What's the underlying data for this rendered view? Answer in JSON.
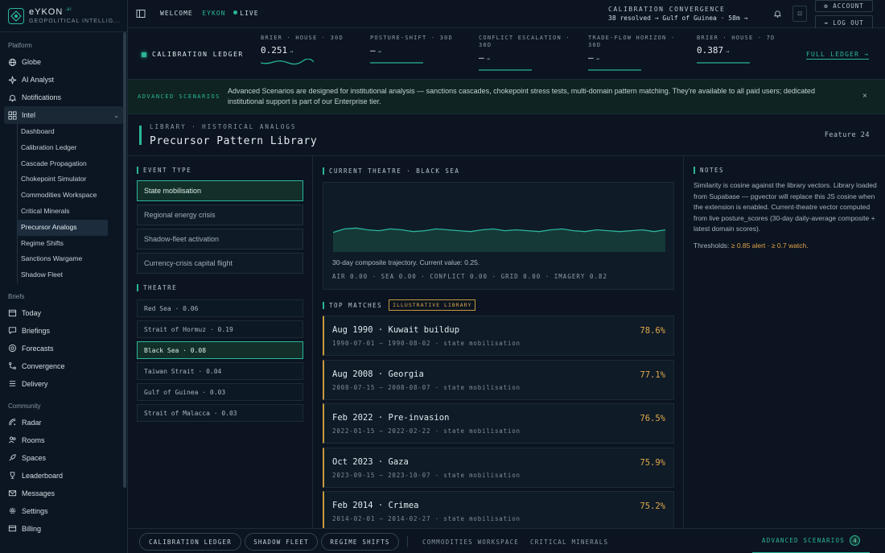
{
  "brand": {
    "name": "eYKON",
    "suffix": ".ai",
    "subtitle": "GEOPOLITICAL INTELLIG..."
  },
  "sidebar": {
    "platform_label": "Platform",
    "platform": [
      {
        "label": "Globe",
        "icon": "globe-icon"
      },
      {
        "label": "AI Analyst",
        "icon": "sparkle-icon"
      },
      {
        "label": "Notifications",
        "icon": "bell-icon"
      }
    ],
    "intel": {
      "label": "Intel",
      "icon": "grid-icon"
    },
    "intel_items": [
      "Dashboard",
      "Calibration Ledger",
      "Cascade Propagation",
      "Chokepoint Simulator",
      "Commodities Workspace",
      "Critical Minerals",
      "Precursor Analogs",
      "Regime Shifts",
      "Sanctions Wargame",
      "Shadow Fleet"
    ],
    "intel_active": "Precursor Analogs",
    "briefs_label": "Briefs",
    "briefs": [
      {
        "label": "Today",
        "icon": "calendar-icon"
      },
      {
        "label": "Briefings",
        "icon": "chat-icon"
      },
      {
        "label": "Forecasts",
        "icon": "target-icon"
      },
      {
        "label": "Convergence",
        "icon": "merge-icon"
      },
      {
        "label": "Delivery",
        "icon": "list-icon"
      }
    ],
    "community_label": "Community",
    "community": [
      {
        "label": "Radar",
        "icon": "radar-icon"
      },
      {
        "label": "Rooms",
        "icon": "people-icon"
      },
      {
        "label": "Spaces",
        "icon": "rocket-icon"
      },
      {
        "label": "Leaderboard",
        "icon": "trophy-icon"
      },
      {
        "label": "Messages",
        "icon": "mail-icon"
      },
      {
        "label": "Settings",
        "icon": "gear-icon"
      },
      {
        "label": "Billing",
        "icon": "card-icon"
      }
    ]
  },
  "topbar": {
    "welcome": "WELCOME",
    "user": "EYKON",
    "live": "LIVE",
    "conv_l1": "CALIBRATION  CONVERGENCE",
    "conv_l2": "38 resolved → Gulf of Guinea · 58m →",
    "small_btn": "⊡",
    "account": "ACCOUNT",
    "logout": "LOG OUT"
  },
  "ledger": {
    "title": "CALIBRATION LEDGER",
    "metrics": [
      {
        "label": "BRIER · HOUSE · 30D",
        "value": "0.251",
        "arrow": "→"
      },
      {
        "label": "POSTURE-SHIFT · 30D",
        "value": "—",
        "arrow": "→"
      },
      {
        "label": "CONFLICT ESCALATION · 30D",
        "value": "—",
        "arrow": "→"
      },
      {
        "label": "TRADE-FLOW HORIZON · 30D",
        "value": "—",
        "arrow": "→"
      },
      {
        "label": "BRIER · HOUSE · 7D",
        "value": "0.387",
        "arrow": "→"
      }
    ],
    "full": "FULL LEDGER →"
  },
  "banner": {
    "tag": "ADVANCED SCENARIOS",
    "text": "Advanced Scenarios are designed for institutional analysis — sanctions cascades, chokepoint stress tests, multi-domain pattern matching. They're available to all paid users; dedicated institutional support is part of our Enterprise tier.",
    "close": "×"
  },
  "header": {
    "crumb": "LIBRARY · HISTORICAL ANALOGS",
    "title": "Precursor Pattern Library",
    "feature": "Feature 24"
  },
  "event_type": {
    "label": "EVENT TYPE",
    "items": [
      "State mobilisation",
      "Regional energy crisis",
      "Shadow-fleet activation",
      "Currency-crisis capital flight"
    ],
    "selected": 0
  },
  "theatre": {
    "label": "THEATRE",
    "items": [
      "Red Sea · 0.06",
      "Strait of Hormuz · 0.19",
      "Black Sea · 0.08",
      "Taiwan Strait · 0.04",
      "Gulf of Guinea · 0.03",
      "Strait of Malacca · 0.03"
    ],
    "selected": 2
  },
  "current": {
    "label": "CURRENT THEATRE · BLACK SEA",
    "caption": "30-day composite trajectory. Current value: 0.25.",
    "dims": "AIR 0.00 · SEA 0.00 · CONFLICT 0.00 · GRID 0.00 · IMAGERY 0.82"
  },
  "chart_data": {
    "type": "area",
    "series": [
      {
        "values": [
          0.22,
          0.26,
          0.27,
          0.25,
          0.24,
          0.26,
          0.25,
          0.23,
          0.24,
          0.26,
          0.25,
          0.24,
          0.23,
          0.25,
          0.26,
          0.24,
          0.25,
          0.24,
          0.23,
          0.25,
          0.26,
          0.24,
          0.23,
          0.25,
          0.24,
          0.23,
          0.24,
          0.25,
          0.23,
          0.25
        ]
      }
    ],
    "ylim": [
      0,
      1
    ]
  },
  "matches": {
    "label": "TOP MATCHES",
    "tag": "ILLUSTRATIVE LIBRARY",
    "items": [
      {
        "title": "Aug 1990 · Kuwait buildup",
        "sub": "1990-07-01 – 1990-08-02 · state mobilisation",
        "pct": "78.6%"
      },
      {
        "title": "Aug 2008 · Georgia",
        "sub": "2008-07-15 – 2008-08-07 · state mobilisation",
        "pct": "77.1%"
      },
      {
        "title": "Feb 2022 · Pre-invasion",
        "sub": "2022-01-15 – 2022-02-22 · state mobilisation",
        "pct": "76.5%"
      },
      {
        "title": "Oct 2023 · Gaza",
        "sub": "2023-09-15 – 2023-10-07 · state mobilisation",
        "pct": "75.9%"
      },
      {
        "title": "Feb 2014 · Crimea",
        "sub": "2014-02-01 – 2014-02-27 · state mobilisation",
        "pct": "75.2%"
      }
    ]
  },
  "notes": {
    "label": "NOTES",
    "body": "Similarity is cosine against the library vectors. Library loaded from Supabase — pgvector will replace this JS cosine when the extension is enabled. Current-theatre vector computed from live posture_scores (30-day daily-average composite + latest domain scores).",
    "th_prefix": "Thresholds:",
    "th_alert": "≥ 0.85 alert",
    "th_sep": "·",
    "th_watch": "≥ 0.7 watch."
  },
  "bottom": {
    "pills": [
      "CALIBRATION LEDGER",
      "SHADOW FLEET",
      "REGIME SHIFTS"
    ],
    "plain": [
      "COMMODITIES WORKSPACE",
      "CRITICAL MINERALS"
    ],
    "adv": "ADVANCED SCENARIOS",
    "adv_count": "4"
  },
  "colors": {
    "accent": "#2bb59b",
    "warn": "#e2aa4c",
    "bg": "#0b1420"
  }
}
